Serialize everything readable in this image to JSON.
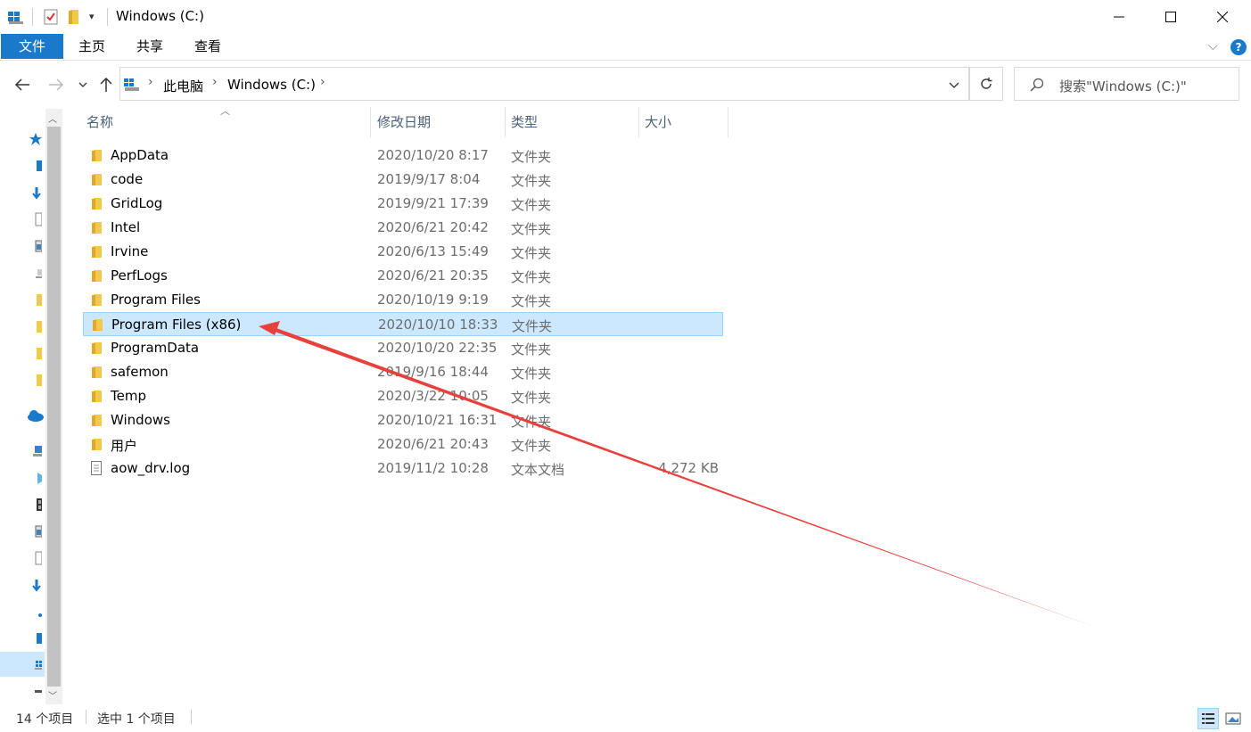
{
  "window": {
    "title": "Windows (C:)",
    "controls": {
      "minimize": "—",
      "maximize": "☐",
      "close": "✕"
    }
  },
  "ribbon": {
    "tabs": [
      "文件",
      "主页",
      "共享",
      "查看"
    ],
    "help": "?"
  },
  "address_bar": {
    "breadcrumbs": [
      "此电脑",
      "Windows (C:)"
    ]
  },
  "search": {
    "placeholder": "搜索\"Windows (C:)\""
  },
  "columns": {
    "name": "名称",
    "date": "修改日期",
    "type": "类型",
    "size": "大小"
  },
  "files": [
    {
      "name": "AppData",
      "date": "2020/10/20 8:17",
      "type": "文件夹",
      "size": "",
      "icon": "folder-icon",
      "selected": false
    },
    {
      "name": "code",
      "date": "2019/9/17 8:04",
      "type": "文件夹",
      "size": "",
      "icon": "folder-icon",
      "selected": false
    },
    {
      "name": "GridLog",
      "date": "2019/9/21 17:39",
      "type": "文件夹",
      "size": "",
      "icon": "folder-icon",
      "selected": false
    },
    {
      "name": "Intel",
      "date": "2020/6/21 20:42",
      "type": "文件夹",
      "size": "",
      "icon": "folder-icon",
      "selected": false
    },
    {
      "name": "Irvine",
      "date": "2020/6/13 15:49",
      "type": "文件夹",
      "size": "",
      "icon": "folder-icon",
      "selected": false
    },
    {
      "name": "PerfLogs",
      "date": "2020/6/21 20:35",
      "type": "文件夹",
      "size": "",
      "icon": "folder-icon",
      "selected": false
    },
    {
      "name": "Program Files",
      "date": "2020/10/19 9:19",
      "type": "文件夹",
      "size": "",
      "icon": "folder-icon",
      "selected": false
    },
    {
      "name": "Program Files (x86)",
      "date": "2020/10/10 18:33",
      "type": "文件夹",
      "size": "",
      "icon": "folder-icon",
      "selected": true
    },
    {
      "name": "ProgramData",
      "date": "2020/10/20 22:35",
      "type": "文件夹",
      "size": "",
      "icon": "folder-icon",
      "selected": false
    },
    {
      "name": "safemon",
      "date": "2019/9/16 18:44",
      "type": "文件夹",
      "size": "",
      "icon": "folder-icon",
      "selected": false
    },
    {
      "name": "Temp",
      "date": "2020/3/22 10:05",
      "type": "文件夹",
      "size": "",
      "icon": "folder-icon",
      "selected": false
    },
    {
      "name": "Windows",
      "date": "2020/10/21 16:31",
      "type": "文件夹",
      "size": "",
      "icon": "folder-icon",
      "selected": false
    },
    {
      "name": "用户",
      "date": "2020/6/21 20:43",
      "type": "文件夹",
      "size": "",
      "icon": "folder-icon",
      "selected": false
    },
    {
      "name": "aow_drv.log",
      "date": "2019/11/2 10:28",
      "type": "文本文档",
      "size": "4,272 KB",
      "icon": "text-file-icon",
      "selected": false
    }
  ],
  "status": {
    "item_count": "14 个项目",
    "selected_count": "选中 1 个项目"
  },
  "colors": {
    "accent": "#1979ca",
    "selection_bg": "#cce8ff",
    "selection_border": "#99d1ff",
    "folder": "#f2c94c",
    "annotation_arrow": "#e8403a"
  }
}
